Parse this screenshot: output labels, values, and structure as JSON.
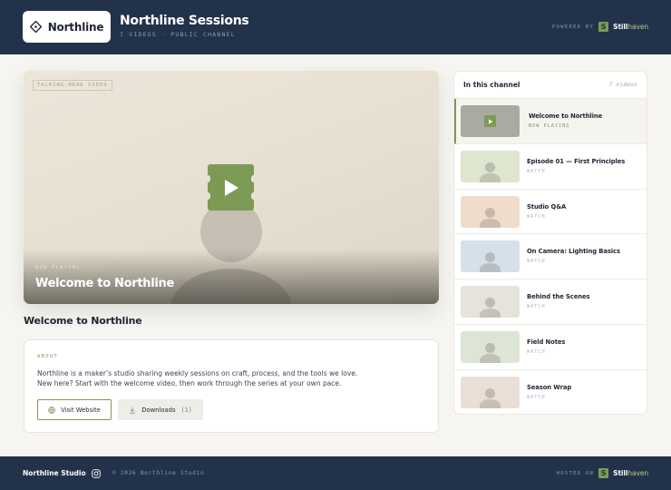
{
  "header": {
    "logo_text": "Northline",
    "channel_title": "Northline Sessions",
    "channel_meta": "7 VIDEOS · PUBLIC CHANNEL",
    "powered_label": "POWERED BY",
    "brand_badge": "S",
    "brand_main": "Still",
    "brand_accent": "haven"
  },
  "player": {
    "tag": "TALKING-HEAD VIDEO",
    "now_playing_label": "NOW PLAYING",
    "title": "Welcome to Northline"
  },
  "video_title": "Welcome to Northline",
  "about": {
    "label": "ABOUT",
    "text_line1": "Northline is a maker’s studio sharing weekly sessions on craft, process, and the tools we love.",
    "text_line2": "New here? Start with the welcome video, then work through the series at your own pace.",
    "website_label": "Visit Website",
    "downloads_label": "Downloads",
    "downloads_count": "(1)"
  },
  "sidebar": {
    "title": "In this channel",
    "count": "7 videos",
    "items": [
      {
        "title": "Welcome to Northline",
        "status": "NOW PLAYING",
        "thumb_color": "#a9aba2"
      },
      {
        "title": "Episode 01 — First Principles",
        "status": "WATCH",
        "thumb_color": "#dfe6cf"
      },
      {
        "title": "Studio Q&A",
        "status": "WATCH",
        "thumb_color": "#f0dccb"
      },
      {
        "title": "On Camera: Lighting Basics",
        "status": "WATCH",
        "thumb_color": "#d5e0ea"
      },
      {
        "title": "Behind the Scenes",
        "status": "WATCH",
        "thumb_color": "#e6e3db"
      },
      {
        "title": "Field Notes",
        "status": "WATCH",
        "thumb_color": "#dde6d4"
      },
      {
        "title": "Season Wrap",
        "status": "WATCH",
        "thumb_color": "#eadfd6"
      }
    ]
  },
  "footer": {
    "brand": "Northline Studio",
    "copyright": "© 2026 Northline Studio",
    "hosted_label": "HOSTED ON",
    "brand_badge": "S",
    "brand_main": "Still",
    "brand_accent": "haven"
  },
  "colors": {
    "navy": "#23324b",
    "accent_green": "#7d9a55",
    "background": "#f6f5f1"
  },
  "icons": {
    "logo": "diamond-icon",
    "website": "globe-icon",
    "downloads": "download-icon",
    "play": "play-icon",
    "social": "instagram-icon"
  }
}
